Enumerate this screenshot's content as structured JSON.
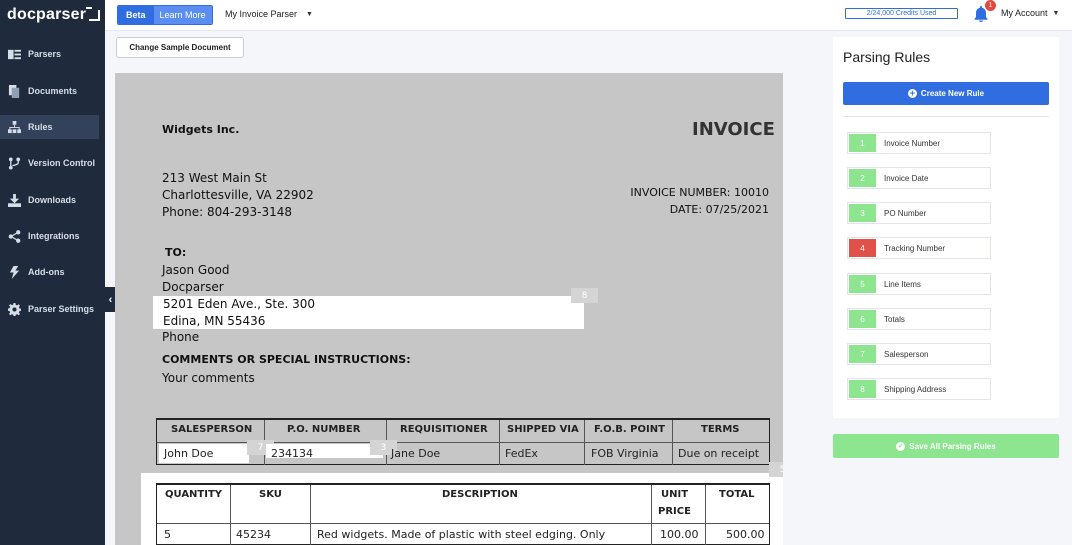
{
  "app": {
    "logo": "docparser",
    "beta_label": "Beta",
    "learn_more_label": "Learn More",
    "parser_name": "My Invoice Parser",
    "credits_label": "2/24,000 Credits Used",
    "notification_count": "1",
    "account_label": "My Account"
  },
  "sidebar": {
    "items": [
      {
        "label": "Parsers",
        "icon": "parsers-icon"
      },
      {
        "label": "Documents",
        "icon": "documents-icon"
      },
      {
        "label": "Rules",
        "icon": "rules-icon"
      },
      {
        "label": "Version Control",
        "icon": "version-control-icon"
      },
      {
        "label": "Downloads",
        "icon": "download-icon"
      },
      {
        "label": "Integrations",
        "icon": "share-icon"
      },
      {
        "label": "Add-ons",
        "icon": "bolt-icon"
      },
      {
        "label": "Parser Settings",
        "icon": "gear-icon"
      }
    ],
    "active": "Rules"
  },
  "toolbar": {
    "change_doc_label": "Change Sample Document"
  },
  "document": {
    "company": "Widgets Inc.",
    "invoice_title": "INVOICE",
    "address1": "213 West Main St",
    "address2": "Charlottesville, VA 22902",
    "phone": "Phone: 804-293-3148",
    "invoice_number": "INVOICE NUMBER:  10010",
    "date": "DATE: 07/25/2021",
    "to_label": "TO:",
    "to_name": "Jason Good",
    "to_company": "Docparser",
    "to_address1": "5201 Eden Ave., Ste. 300",
    "to_address2": "Edina, MN 55436",
    "to_phone": "Phone",
    "comments_label": "COMMENTS OR SPECIAL INSTRUCTIONS:",
    "comments": "Your comments",
    "ship_headers": [
      "SALESPERSON",
      "P.O. NUMBER",
      "REQUISITIONER",
      "SHIPPED VIA",
      "F.O.B. POINT",
      "TERMS"
    ],
    "ship_values": [
      "John Doe",
      "234134",
      "Jane Doe",
      "FedEx",
      "FOB Virginia",
      "Due on receipt"
    ],
    "item_headers": {
      "qty": "QUANTITY",
      "sku": "SKU",
      "desc": "DESCRIPTION",
      "unit1": "UNIT",
      "unit2": "PRICE",
      "total": "TOTAL"
    },
    "item_row": {
      "qty": "5",
      "sku": "45234",
      "desc": "Red widgets. Made of plastic with steel edging. Only",
      "unit": "100.00",
      "total": "500.00"
    },
    "region_labels": {
      "address": "8",
      "salesperson": "7",
      "po": "3",
      "items": "5"
    }
  },
  "rules_panel": {
    "title": "Parsing Rules",
    "create_label": "Create New Rule",
    "save_label": "Save All Parsing Rules",
    "rules": [
      {
        "num": "1",
        "name": "Invoice Number",
        "color": "#8de58f"
      },
      {
        "num": "2",
        "name": "Invoice Date",
        "color": "#8de58f"
      },
      {
        "num": "3",
        "name": "PO Number",
        "color": "#8de58f"
      },
      {
        "num": "4",
        "name": "Tracking Number",
        "color": "#e0514a"
      },
      {
        "num": "5",
        "name": "Line Items",
        "color": "#8de58f"
      },
      {
        "num": "6",
        "name": "Totals",
        "color": "#8de58f"
      },
      {
        "num": "7",
        "name": "Salesperson",
        "color": "#8de58f"
      },
      {
        "num": "8",
        "name": "Shipping Address",
        "color": "#8de58f"
      }
    ]
  },
  "colors": {
    "accent": "#2f6de0",
    "sidebar": "#1f2b3d",
    "success": "#8de58f",
    "danger": "#e0514a"
  }
}
